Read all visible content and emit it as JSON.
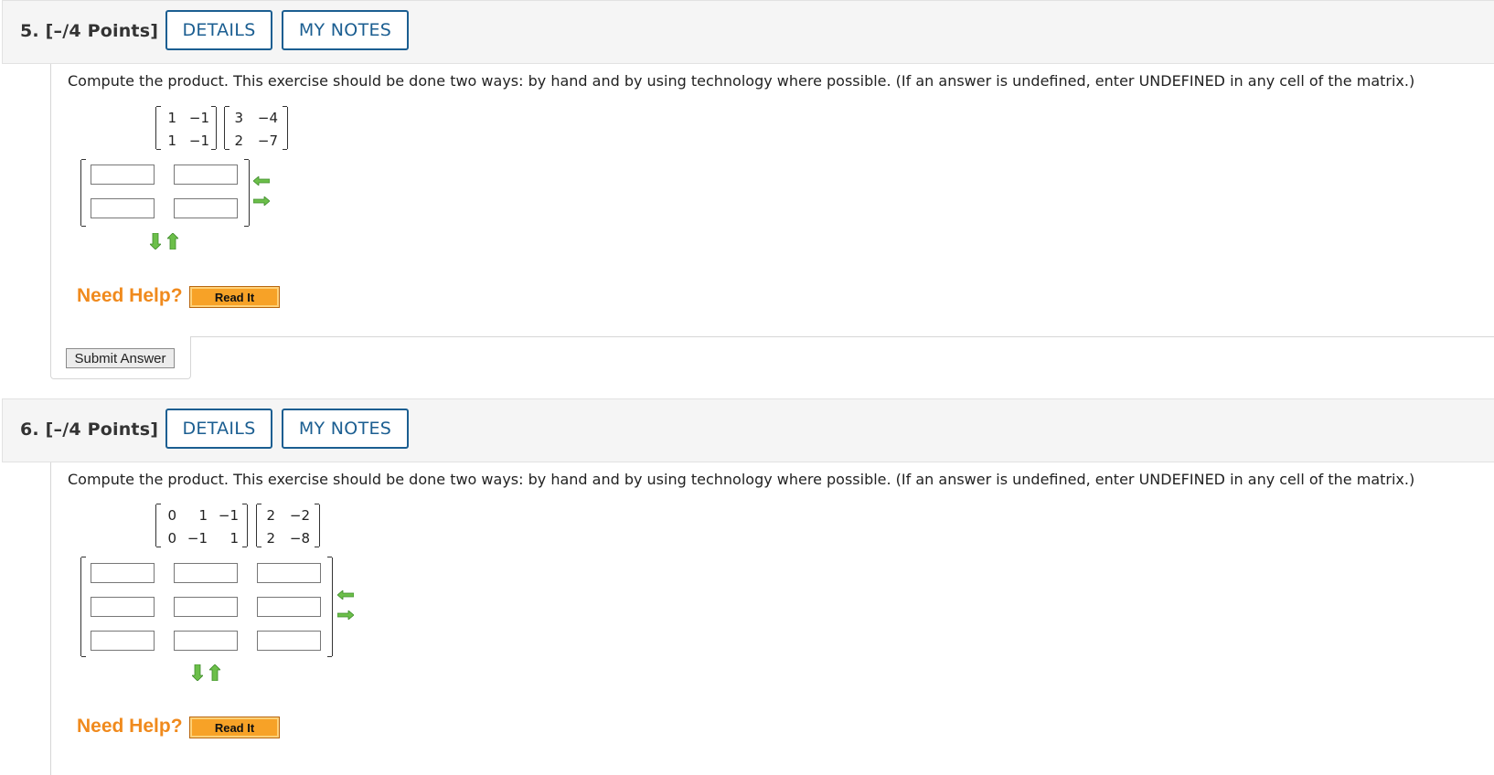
{
  "questions": [
    {
      "number_label": "5. [–/4 Points]",
      "details_label": "DETAILS",
      "notes_label": "MY NOTES",
      "prompt": "Compute the product. This exercise should be done two ways: by hand and by using technology where possible. (If an answer is undefined, enter UNDEFINED in any cell of the matrix.)",
      "matrix_a": [
        [
          "1",
          "−1"
        ],
        [
          "1",
          "−1"
        ]
      ],
      "matrix_b": [
        [
          "3",
          "−4"
        ],
        [
          "2",
          "−7"
        ]
      ],
      "answer_grid": {
        "rows": 2,
        "cols": 2
      },
      "need_help_label": "Need Help?",
      "read_it_label": "Read It",
      "submit_label": "Submit Answer"
    },
    {
      "number_label": "6. [–/4 Points]",
      "details_label": "DETAILS",
      "notes_label": "MY NOTES",
      "prompt": "Compute the product. This exercise should be done two ways: by hand and by using technology where possible. (If an answer is undefined, enter UNDEFINED in any cell of the matrix.)",
      "matrix_a": [
        [
          "0",
          "1",
          "−1"
        ],
        [
          "0",
          "−1",
          "1"
        ]
      ],
      "matrix_b": [
        [
          "2",
          "−2"
        ],
        [
          "2",
          "−8"
        ]
      ],
      "answer_grid": {
        "rows": 3,
        "cols": 3
      },
      "need_help_label": "Need Help?",
      "read_it_label": "Read It"
    }
  ],
  "icons": {
    "remove_column": "arrow-left-icon",
    "add_column": "arrow-right-icon",
    "add_row": "arrow-down-icon",
    "remove_row": "arrow-up-icon"
  },
  "colors": {
    "button_blue": "#1b5e91",
    "need_help_orange": "#f08a1d",
    "read_it_fill": "#f7a227",
    "arrow_green": "#6cbf4a"
  }
}
